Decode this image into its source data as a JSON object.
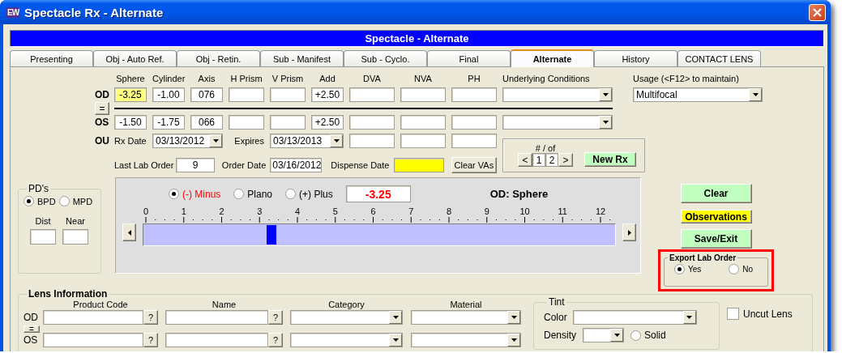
{
  "window": {
    "app_icon": "EW",
    "title": "Spectacle Rx - Alternate"
  },
  "banner": "Spectacle - Alternate",
  "tabs": [
    {
      "label": "Presenting",
      "selected": false
    },
    {
      "label": "Obj - Auto Ref.",
      "selected": false
    },
    {
      "label": "Obj - Retin.",
      "selected": false
    },
    {
      "label": "Sub - Manifest",
      "selected": false
    },
    {
      "label": "Sub - Cyclo.",
      "selected": false
    },
    {
      "label": "Final",
      "selected": false
    },
    {
      "label": "Alternate",
      "selected": true
    },
    {
      "label": "History",
      "selected": false
    },
    {
      "label": "CONTACT LENS",
      "selected": false
    }
  ],
  "rx": {
    "columns": [
      "Sphere",
      "Cylinder",
      "Axis",
      "H Prism",
      "V Prism",
      "Add",
      "DVA",
      "NVA",
      "PH",
      "Underlying Conditions"
    ],
    "copy_button": "=",
    "rows": [
      {
        "label": "OD",
        "sphere": "-3.25",
        "cylinder": "-1.00",
        "axis": "076",
        "add": "+2.50",
        "sphere_highlighted": true
      },
      {
        "label": "OS",
        "sphere": "-1.50",
        "cylinder": "-1.75",
        "axis": "066",
        "add": "+2.50",
        "sphere_highlighted": false
      }
    ],
    "ou": {
      "label": "OU",
      "rx_date_label": "Rx Date",
      "rx_date": "03/13/2012",
      "expires_label": "Expires",
      "expires": "03/13/2013"
    },
    "usage": {
      "label": "Usage (<F12> to maintain)",
      "value": "Multifocal"
    }
  },
  "lab": {
    "last_lab_order_label": "Last Lab Order",
    "last_lab_order": "9",
    "order_date_label": "Order Date",
    "order_date": "03/16/2012",
    "dispense_date_label": "Dispense Date",
    "dispense_highlighted": true,
    "clear_button": "Clear VAs"
  },
  "nav": {
    "label": "# / of",
    "prev": "<",
    "current": "1",
    "total": "2",
    "next": ">",
    "new_button": "New Rx"
  },
  "pd": {
    "title": "PD's",
    "options": [
      {
        "label": "BPD",
        "selected": true
      },
      {
        "label": "MPD",
        "selected": false
      }
    ],
    "dist_label": "Dist",
    "near_label": "Near"
  },
  "slider": {
    "options": [
      {
        "label": "(-) Minus",
        "selected": true
      },
      {
        "label": "Plano",
        "selected": false
      },
      {
        "label": "(+) Plus",
        "selected": false
      }
    ],
    "value": "-3.25",
    "title": "OD: Sphere",
    "scale": [
      "0",
      "1",
      "2",
      "3",
      "4",
      "5",
      "6",
      "7",
      "8",
      "9",
      "10",
      "11",
      "12"
    ],
    "level": 0.262
  },
  "actions": [
    {
      "label": "Clear",
      "color": "#c0ffc0"
    },
    {
      "label": "Observations",
      "color": "#ffff00"
    },
    {
      "label": "Save/Exit",
      "color": "#c0ffc0"
    }
  ],
  "export": {
    "title": "Export Lab Order",
    "options": [
      {
        "label": "Yes",
        "selected": true
      },
      {
        "label": "No",
        "selected": false
      }
    ]
  },
  "lens": {
    "title": "Lens Information",
    "columns": [
      "Product Code",
      "Name",
      "Category",
      "Material"
    ],
    "copy_button": "=",
    "lookup_button": "?",
    "rows": [
      {
        "label": "OD"
      },
      {
        "label": "OS"
      }
    ],
    "tint": {
      "title": "Tint",
      "color_label": "Color",
      "density_label": "Density",
      "options": [
        {
          "label": "Solid",
          "selected": false
        }
      ]
    },
    "uncut": {
      "label": "Uncut Lens",
      "checked": false
    }
  }
}
